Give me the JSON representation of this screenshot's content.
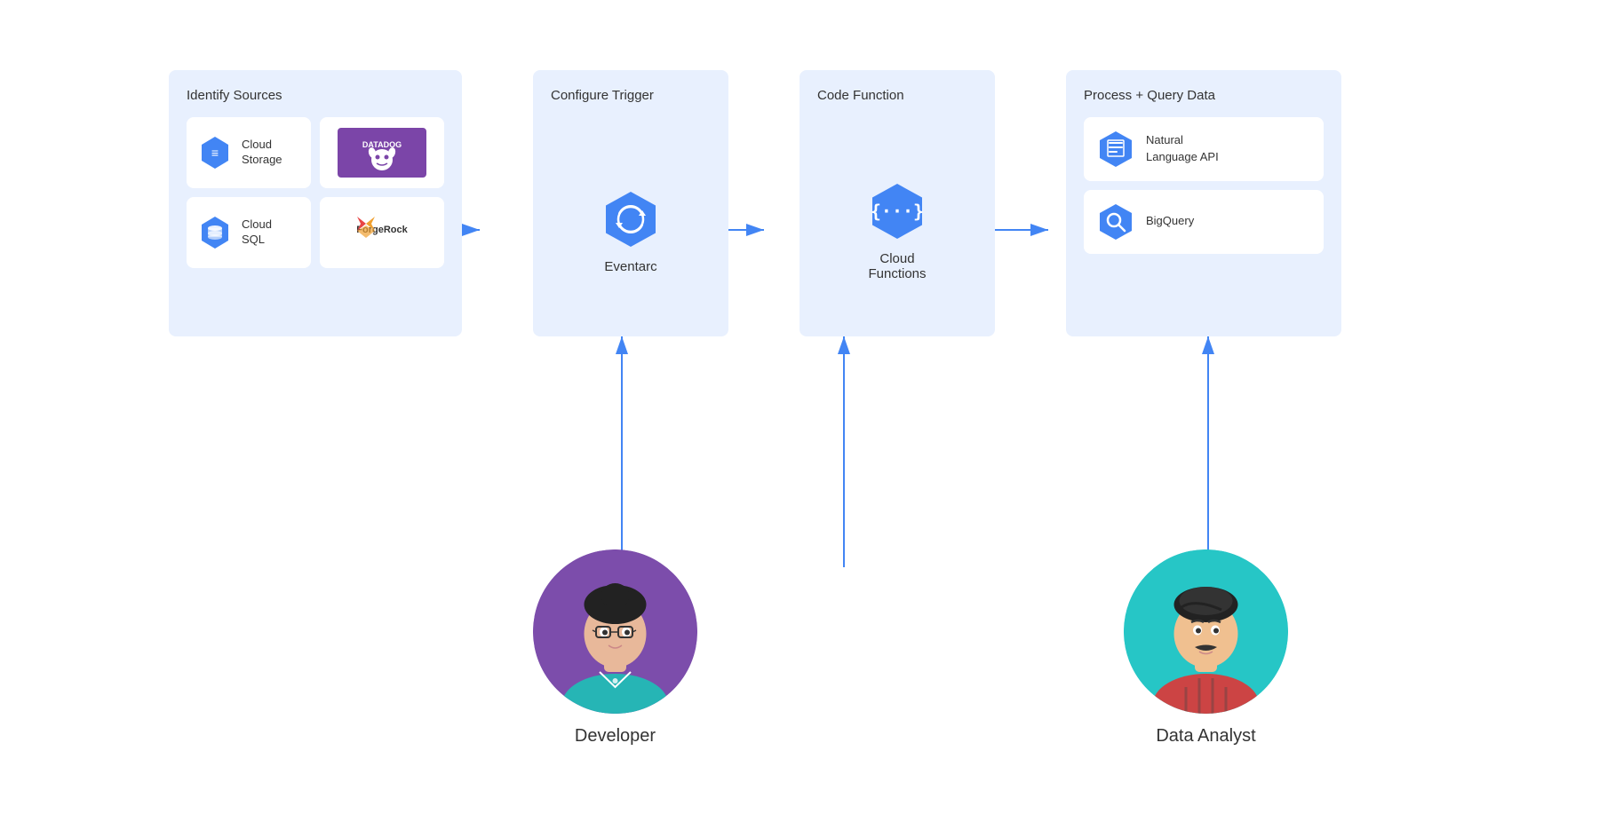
{
  "panels": {
    "identify": {
      "title": "Identify Sources",
      "sources": [
        {
          "id": "cloud-storage",
          "label": "Cloud\nStorage",
          "type": "gcp",
          "icon": "storage"
        },
        {
          "id": "datadog",
          "label": "Datadog",
          "type": "logo",
          "logo": "datadog"
        },
        {
          "id": "cloud-sql",
          "label": "Cloud\nSQL",
          "type": "gcp",
          "icon": "sql"
        },
        {
          "id": "forgerock",
          "label": "ForgeRock",
          "type": "logo",
          "logo": "forgerock"
        }
      ]
    },
    "trigger": {
      "title": "Configure Trigger",
      "service": {
        "id": "eventarc",
        "label": "Eventarc",
        "type": "gcp"
      }
    },
    "function": {
      "title": "Code Function",
      "service": {
        "id": "cloud-functions",
        "label": "Cloud\nFunctions",
        "type": "gcp"
      }
    },
    "process": {
      "title": "Process + Query Data",
      "items": [
        {
          "id": "natural-language-api",
          "label": "Natural\nLanguage API",
          "type": "gcp"
        },
        {
          "id": "bigquery",
          "label": "BigQuery",
          "type": "gcp"
        }
      ]
    }
  },
  "personas": [
    {
      "id": "developer",
      "name": "Developer",
      "avatarType": "developer"
    },
    {
      "id": "data-analyst",
      "name": "Data Analyst",
      "avatarType": "analyst"
    }
  ],
  "colors": {
    "panelBg": "#dce8fd",
    "cardBg": "#ffffff",
    "arrowColor": "#4285F4",
    "gcpBlue": "#4285F4",
    "titleText": "#333333",
    "labelText": "#333333"
  }
}
